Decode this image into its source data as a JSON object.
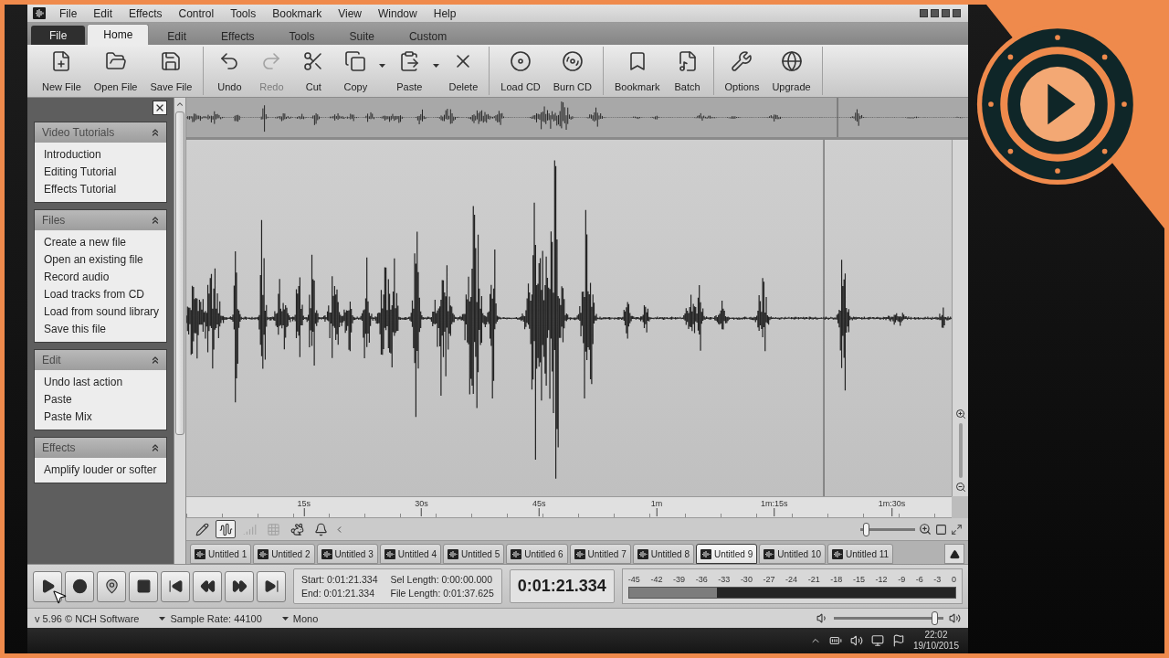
{
  "menu": {
    "items": [
      "File",
      "Edit",
      "Effects",
      "Control",
      "Tools",
      "Bookmark",
      "View",
      "Window",
      "Help"
    ]
  },
  "ribbon": {
    "app_tab": "File",
    "tabs": [
      {
        "label": "Home",
        "selected": true
      },
      {
        "label": "Edit",
        "selected": false
      },
      {
        "label": "Effects",
        "selected": false
      },
      {
        "label": "Tools",
        "selected": false
      },
      {
        "label": "Suite",
        "selected": false
      },
      {
        "label": "Custom",
        "selected": false
      }
    ]
  },
  "toolbar": {
    "groups": [
      {
        "buttons": [
          {
            "label": "New File",
            "disabled": false,
            "has_menu": false
          },
          {
            "label": "Open File",
            "disabled": false,
            "has_menu": false
          },
          {
            "label": "Save File",
            "disabled": false,
            "has_menu": false
          }
        ]
      },
      {
        "buttons": [
          {
            "label": "Undo",
            "disabled": false,
            "has_menu": false
          },
          {
            "label": "Redo",
            "disabled": true,
            "has_menu": false
          },
          {
            "label": "Cut",
            "disabled": false,
            "has_menu": false
          },
          {
            "label": "Copy",
            "disabled": false,
            "has_menu": true
          },
          {
            "label": "Paste",
            "disabled": false,
            "has_menu": true
          },
          {
            "label": "Delete",
            "disabled": false,
            "has_menu": false
          }
        ]
      },
      {
        "buttons": [
          {
            "label": "Load CD",
            "disabled": false,
            "has_menu": false
          },
          {
            "label": "Burn CD",
            "disabled": false,
            "has_menu": false
          }
        ]
      },
      {
        "buttons": [
          {
            "label": "Bookmark",
            "disabled": false,
            "has_menu": false
          },
          {
            "label": "Batch",
            "disabled": false,
            "has_menu": false
          }
        ]
      },
      {
        "buttons": [
          {
            "label": "Options",
            "disabled": false,
            "has_menu": false
          },
          {
            "label": "Upgrade",
            "disabled": false,
            "has_menu": false
          }
        ]
      }
    ]
  },
  "sidebar": {
    "panels": [
      {
        "title": "Video Tutorials",
        "expanded": true,
        "items": [
          "Introduction",
          "Editing Tutorial",
          "Effects Tutorial"
        ]
      },
      {
        "title": "Files",
        "expanded": true,
        "items": [
          "Create a new file",
          "Open an existing file",
          "Record audio",
          "Load tracks from CD",
          "Load from sound library",
          "Save this file"
        ]
      },
      {
        "title": "Edit",
        "expanded": true,
        "items": [
          "Undo last action",
          "Paste",
          "Paste Mix"
        ]
      },
      {
        "title": "Effects",
        "expanded": true,
        "items": [
          "Amplify louder or softer"
        ]
      }
    ]
  },
  "timeline": {
    "labels": [
      "15s",
      "30s",
      "45s",
      "1m",
      "1m:15s",
      "1m:30s"
    ]
  },
  "tools": [
    {
      "selected": false,
      "disabled": false
    },
    {
      "selected": true,
      "disabled": false
    },
    {
      "selected": false,
      "disabled": true
    },
    {
      "selected": false,
      "disabled": true
    },
    {
      "selected": false,
      "disabled": false
    },
    {
      "selected": false,
      "disabled": false
    }
  ],
  "zoom": {
    "level": 0.05
  },
  "file_tabs": [
    {
      "label": "Untitled 1",
      "selected": false
    },
    {
      "label": "Untitled 2",
      "selected": false
    },
    {
      "label": "Untitled 3",
      "selected": false
    },
    {
      "label": "Untitled 4",
      "selected": false
    },
    {
      "label": "Untitled 5",
      "selected": false
    },
    {
      "label": "Untitled 6",
      "selected": false
    },
    {
      "label": "Untitled 7",
      "selected": false
    },
    {
      "label": "Untitled 8",
      "selected": false
    },
    {
      "label": "Untitled 9",
      "selected": true
    },
    {
      "label": "Untitled 10",
      "selected": false
    },
    {
      "label": "Untitled 11",
      "selected": false
    }
  ],
  "selection_info": [
    "Start: 0:01:21.334",
    "End: 0:01:21.334",
    "Sel Length: 0:00:00.000",
    "File Length: 0:01:37.625"
  ],
  "position": "0:01:21.334",
  "meter": {
    "scale": [
      "-45",
      "-42",
      "-39",
      "-36",
      "-33",
      "-30",
      "-27",
      "-24",
      "-21",
      "-18",
      "-15",
      "-12",
      "-9",
      "-6",
      "-3",
      "0"
    ],
    "level": 0.27
  },
  "status_bar": {
    "version": "v 5.96 © NCH Software",
    "sample_rate": "Sample Rate: 44100",
    "channels": "Mono"
  },
  "volume": {
    "level": 0.95
  },
  "taskbar": {
    "time": "22:02",
    "date": "19/10/2015"
  }
}
